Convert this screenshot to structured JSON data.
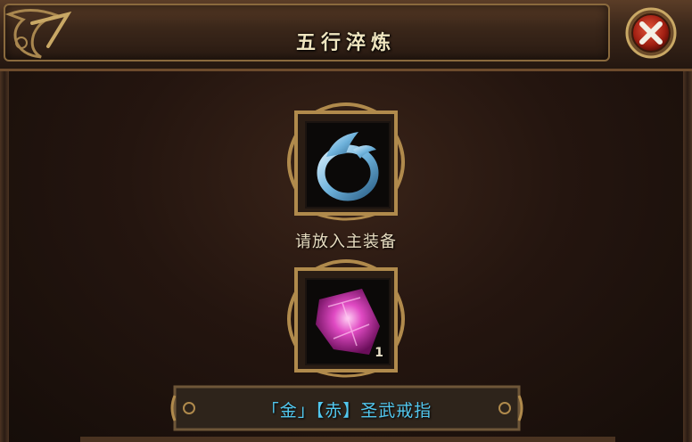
{
  "window": {
    "title": "五行淬炼"
  },
  "slots": {
    "main_equipment": {
      "icon": "ring-icon",
      "prompt": "请放入主装备"
    },
    "material": {
      "icon": "crystal-icon",
      "count": "1"
    }
  },
  "item": {
    "name": "「金」【赤】圣武戒指"
  },
  "colors": {
    "title_text": "#efe5bf",
    "item_name": "#52c7ee",
    "frame_gold": "#b08a4c",
    "close_red": "#b5271a"
  }
}
